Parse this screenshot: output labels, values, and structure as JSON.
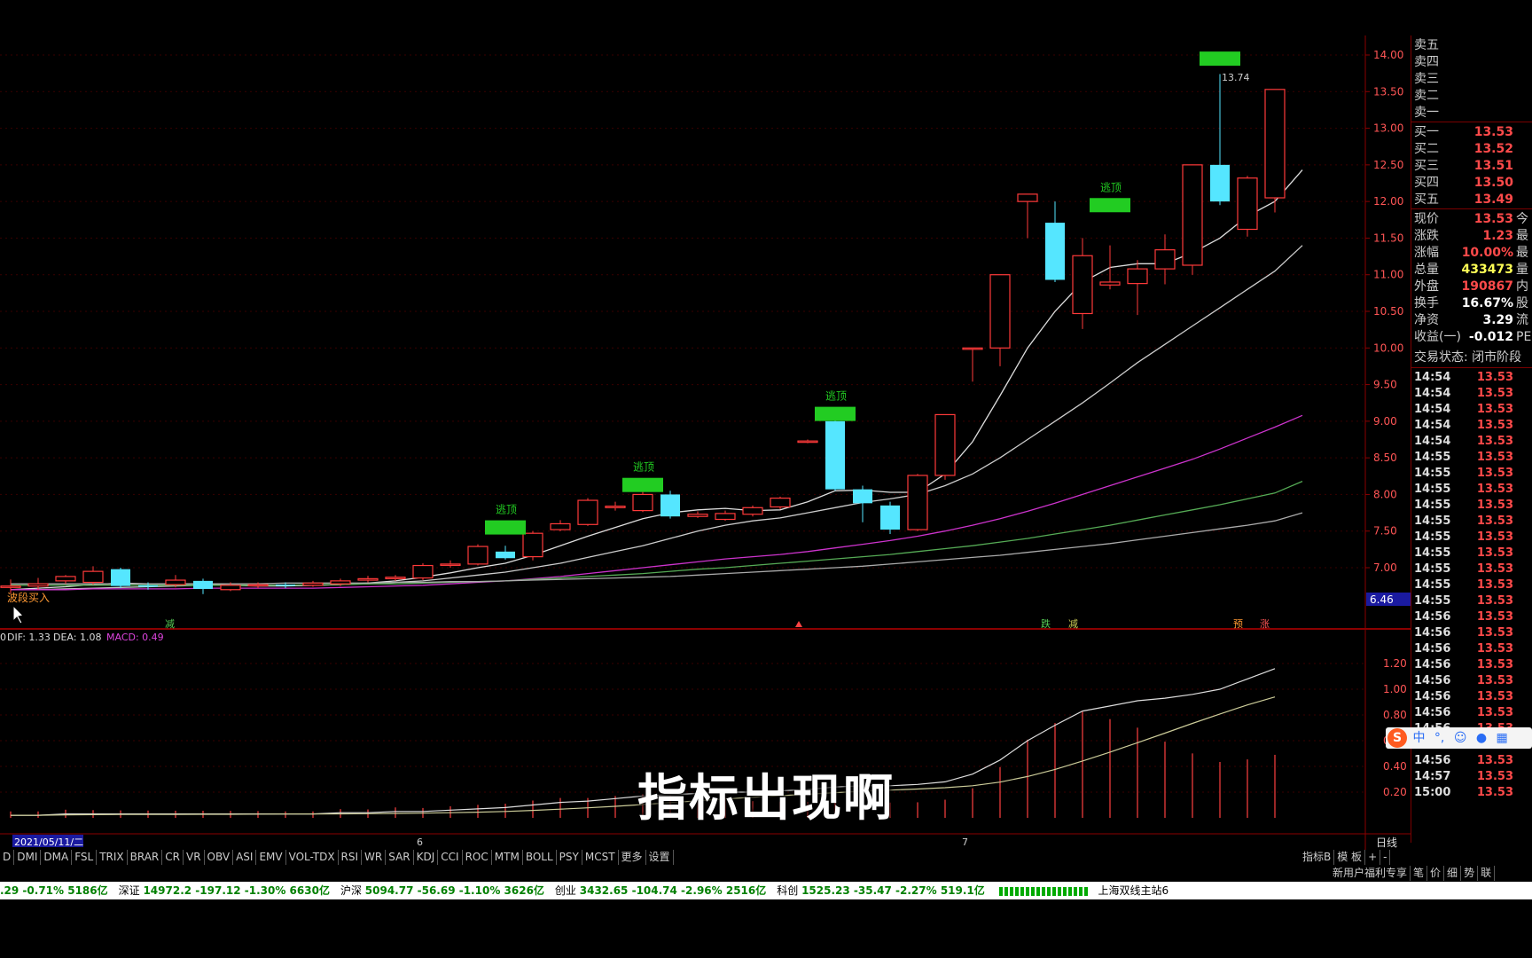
{
  "colors": {
    "up": "#ff3a3a",
    "down": "#55e6ff",
    "signal": "#22cc22",
    "ma5": "#dddddd",
    "ma10": "#cccccc",
    "ma20": "#cc33cc",
    "ma30": "#55aa55",
    "ma60": "#aaaaaa"
  },
  "chart": {
    "price_axis": [
      "14.00",
      "13.50",
      "13.00",
      "12.50",
      "12.00",
      "11.50",
      "11.00",
      "10.50",
      "10.00",
      "9.50",
      "9.00",
      "8.50",
      "8.00",
      "7.50",
      "7.00"
    ],
    "macd_axis": [
      "1.20",
      "1.00",
      "0.80",
      "0.60",
      "0.40",
      "0.20"
    ],
    "current_price_tag": "6.46",
    "high_label": "13.74",
    "buy_label": "波段买入",
    "top_labels": [
      "逃顶",
      "逃顶",
      "逃顶",
      "逃顶"
    ],
    "marker_labels": [
      "减",
      "跌",
      "减",
      "预",
      "涨"
    ],
    "macd_legend": {
      "dif": "DIF: 1.33",
      "dea": "DEA: 1.08",
      "macd": "MACD: 0.49"
    },
    "date_labels": [
      "2021/05/11/二",
      "6",
      "7"
    ],
    "period": "日线",
    "caption": "指标出现啊"
  },
  "chart_data": {
    "type": "candlestick",
    "series": [
      {
        "o": 6.73,
        "c": 6.75,
        "h": 6.84,
        "l": 6.65
      },
      {
        "o": 6.75,
        "c": 6.78,
        "h": 6.86,
        "l": 6.7
      },
      {
        "o": 6.82,
        "c": 6.88,
        "h": 6.9,
        "l": 6.78
      },
      {
        "o": 6.8,
        "c": 6.95,
        "h": 7.02,
        "l": 6.77
      },
      {
        "o": 6.98,
        "c": 6.75,
        "h": 7.0,
        "l": 6.72
      },
      {
        "o": 6.76,
        "c": 6.74,
        "h": 6.8,
        "l": 6.7
      },
      {
        "o": 6.77,
        "c": 6.83,
        "h": 6.9,
        "l": 6.73
      },
      {
        "o": 6.82,
        "c": 6.71,
        "h": 6.85,
        "l": 6.64
      },
      {
        "o": 6.7,
        "c": 6.76,
        "h": 6.8,
        "l": 6.68
      },
      {
        "o": 6.76,
        "c": 6.77,
        "h": 6.8,
        "l": 6.72
      },
      {
        "o": 6.77,
        "c": 6.76,
        "h": 6.8,
        "l": 6.72
      },
      {
        "o": 6.76,
        "c": 6.79,
        "h": 6.82,
        "l": 6.74
      },
      {
        "o": 6.78,
        "c": 6.82,
        "h": 6.85,
        "l": 6.75
      },
      {
        "o": 6.83,
        "c": 6.85,
        "h": 6.89,
        "l": 6.8
      },
      {
        "o": 6.85,
        "c": 6.87,
        "h": 6.9,
        "l": 6.82
      },
      {
        "o": 6.86,
        "c": 7.03,
        "h": 7.06,
        "l": 6.83
      },
      {
        "o": 7.04,
        "c": 7.05,
        "h": 7.1,
        "l": 7.0
      },
      {
        "o": 7.05,
        "c": 7.29,
        "h": 7.32,
        "l": 7.03
      },
      {
        "o": 7.22,
        "c": 7.13,
        "h": 7.3,
        "l": 7.11
      },
      {
        "o": 7.15,
        "c": 7.47,
        "h": 7.5,
        "l": 7.1
      },
      {
        "o": 7.52,
        "c": 7.6,
        "h": 7.65,
        "l": 7.5
      },
      {
        "o": 7.59,
        "c": 7.92,
        "h": 7.95,
        "l": 7.57
      },
      {
        "o": 7.82,
        "c": 7.84,
        "h": 7.9,
        "l": 7.78
      },
      {
        "o": 7.78,
        "c": 8.0,
        "h": 8.04,
        "l": 7.76
      },
      {
        "o": 8.0,
        "c": 7.7,
        "h": 8.05,
        "l": 7.67
      },
      {
        "o": 7.7,
        "c": 7.73,
        "h": 7.77,
        "l": 7.68
      },
      {
        "o": 7.66,
        "c": 7.74,
        "h": 7.78,
        "l": 7.64
      },
      {
        "o": 7.73,
        "c": 7.82,
        "h": 7.85,
        "l": 7.7
      },
      {
        "o": 7.83,
        "c": 7.95,
        "h": 7.97,
        "l": 7.8
      },
      {
        "o": 8.73,
        "c": 8.73,
        "h": 8.75,
        "l": 8.7
      },
      {
        "o": 9.0,
        "c": 8.07,
        "h": 9.1,
        "l": 8.05
      },
      {
        "o": 8.07,
        "c": 7.88,
        "h": 8.12,
        "l": 7.62
      },
      {
        "o": 7.85,
        "c": 7.52,
        "h": 7.9,
        "l": 7.46
      },
      {
        "o": 7.52,
        "c": 8.26,
        "h": 8.28,
        "l": 7.5
      },
      {
        "o": 8.26,
        "c": 9.09,
        "h": 9.09,
        "l": 8.2
      },
      {
        "o": 10.0,
        "c": 10.0,
        "h": 10.0,
        "l": 9.54
      },
      {
        "o": 10.0,
        "c": 11.0,
        "h": 11.0,
        "l": 9.75
      },
      {
        "o": 12.0,
        "c": 12.1,
        "h": 12.1,
        "l": 11.5
      },
      {
        "o": 11.71,
        "c": 10.93,
        "h": 12.0,
        "l": 10.9
      },
      {
        "o": 10.47,
        "c": 11.26,
        "h": 11.5,
        "l": 10.26
      },
      {
        "o": 10.86,
        "c": 10.9,
        "h": 11.4,
        "l": 10.8
      },
      {
        "o": 10.88,
        "c": 11.08,
        "h": 11.2,
        "l": 10.45
      },
      {
        "o": 11.08,
        "c": 11.34,
        "h": 11.55,
        "l": 10.87
      },
      {
        "o": 11.13,
        "c": 12.5,
        "h": 12.5,
        "l": 11.0
      },
      {
        "o": 12.5,
        "c": 12.0,
        "h": 13.74,
        "l": 11.95
      },
      {
        "o": 11.62,
        "c": 12.32,
        "h": 12.35,
        "l": 11.52
      },
      {
        "o": 12.05,
        "c": 13.53,
        "h": 13.53,
        "l": 11.85
      }
    ],
    "ma": [
      {
        "name": "MA5",
        "values": [
          6.7,
          6.72,
          6.74,
          6.77,
          6.79,
          6.78,
          6.78,
          6.78,
          6.76,
          6.75,
          6.75,
          6.76,
          6.77,
          6.79,
          6.82,
          6.87,
          6.93,
          7.0,
          7.06,
          7.17,
          7.3,
          7.43,
          7.55,
          7.67,
          7.75,
          7.79,
          7.81,
          7.78,
          7.79,
          7.9,
          8.05,
          8.06,
          8.03,
          8.03,
          8.28,
          8.72,
          9.35,
          10.0,
          10.5,
          10.9,
          11.1,
          11.15,
          11.15,
          11.3,
          11.5,
          11.8,
          12.0,
          12.43
        ]
      },
      {
        "name": "MA10",
        "values": [
          6.7,
          6.7,
          6.71,
          6.72,
          6.73,
          6.74,
          6.75,
          6.76,
          6.76,
          6.76,
          6.76,
          6.76,
          6.77,
          6.78,
          6.8,
          6.82,
          6.86,
          6.9,
          6.94,
          7.0,
          7.06,
          7.14,
          7.22,
          7.3,
          7.4,
          7.5,
          7.58,
          7.64,
          7.68,
          7.75,
          7.82,
          7.89,
          7.94,
          8.0,
          8.12,
          8.28,
          8.5,
          8.75,
          9.0,
          9.25,
          9.52,
          9.8,
          10.05,
          10.3,
          10.55,
          10.8,
          11.05,
          11.4
        ]
      },
      {
        "name": "MA20",
        "values": [
          6.7,
          6.7,
          6.7,
          6.71,
          6.71,
          6.71,
          6.71,
          6.72,
          6.72,
          6.72,
          6.72,
          6.72,
          6.73,
          6.74,
          6.75,
          6.76,
          6.78,
          6.8,
          6.82,
          6.85,
          6.88,
          6.92,
          6.96,
          7.0,
          7.04,
          7.08,
          7.12,
          7.15,
          7.18,
          7.22,
          7.27,
          7.32,
          7.37,
          7.43,
          7.5,
          7.58,
          7.67,
          7.77,
          7.88,
          8.0,
          8.12,
          8.24,
          8.36,
          8.48,
          8.62,
          8.77,
          8.92,
          9.08
        ]
      },
      {
        "name": "MA30",
        "values": [
          6.76,
          6.76,
          6.76,
          6.76,
          6.76,
          6.76,
          6.76,
          6.76,
          6.76,
          6.76,
          6.76,
          6.77,
          6.77,
          6.78,
          6.78,
          6.79,
          6.8,
          6.81,
          6.82,
          6.84,
          6.86,
          6.88,
          6.9,
          6.92,
          6.95,
          6.98,
          7.0,
          7.03,
          7.06,
          7.09,
          7.12,
          7.15,
          7.18,
          7.22,
          7.26,
          7.3,
          7.35,
          7.4,
          7.46,
          7.52,
          7.58,
          7.65,
          7.72,
          7.79,
          7.86,
          7.94,
          8.02,
          8.18
        ]
      },
      {
        "name": "MA60",
        "values": [
          6.78,
          6.78,
          6.78,
          6.78,
          6.78,
          6.78,
          6.78,
          6.78,
          6.78,
          6.78,
          6.79,
          6.79,
          6.79,
          6.79,
          6.8,
          6.8,
          6.81,
          6.81,
          6.82,
          6.83,
          6.84,
          6.85,
          6.86,
          6.87,
          6.88,
          6.9,
          6.92,
          6.94,
          6.96,
          6.98,
          7.0,
          7.02,
          7.05,
          7.08,
          7.11,
          7.14,
          7.17,
          7.21,
          7.25,
          7.29,
          7.33,
          7.38,
          7.43,
          7.48,
          7.53,
          7.58,
          7.64,
          7.75
        ]
      }
    ],
    "macd": {
      "dif": [
        0.02,
        0.02,
        0.03,
        0.03,
        0.03,
        0.03,
        0.03,
        0.03,
        0.03,
        0.03,
        0.03,
        0.03,
        0.04,
        0.04,
        0.05,
        0.05,
        0.06,
        0.07,
        0.08,
        0.1,
        0.12,
        0.13,
        0.15,
        0.17,
        0.18,
        0.19,
        0.2,
        0.2,
        0.21,
        0.22,
        0.24,
        0.25,
        0.25,
        0.26,
        0.28,
        0.34,
        0.45,
        0.6,
        0.72,
        0.83,
        0.87,
        0.91,
        0.93,
        0.96,
        1.0,
        1.08,
        1.16,
        1.22,
        1.33
      ]
    },
    "sell_signals": [
      {
        "index": 18,
        "price": 7.55
      },
      {
        "index": 23,
        "price": 8.13
      },
      {
        "index": 30,
        "price": 9.1
      },
      {
        "index": 40,
        "price": 11.95
      },
      {
        "index": 44,
        "price": 13.95
      }
    ],
    "xlabel": "",
    "ylabel": ""
  },
  "quote": {
    "asks": [
      {
        "label": "卖五",
        "value": ""
      },
      {
        "label": "卖四",
        "value": ""
      },
      {
        "label": "卖三",
        "value": ""
      },
      {
        "label": "卖二",
        "value": ""
      },
      {
        "label": "卖一",
        "value": ""
      }
    ],
    "bids": [
      {
        "label": "买一",
        "value": "13.53"
      },
      {
        "label": "买二",
        "value": "13.52"
      },
      {
        "label": "买三",
        "value": "13.51"
      },
      {
        "label": "买四",
        "value": "13.50"
      },
      {
        "label": "买五",
        "value": "13.49"
      }
    ],
    "stats": [
      {
        "label": "现价",
        "value": "13.53",
        "extra": "今"
      },
      {
        "label": "涨跌",
        "value": "1.23",
        "extra": "最"
      },
      {
        "label": "涨幅",
        "value": "10.00%",
        "extra": "最"
      },
      {
        "label": "总量",
        "value": "433473",
        "extra": "量"
      },
      {
        "label": "外盘",
        "value": "190867",
        "extra": "内"
      },
      {
        "label": "换手",
        "value": "16.67%",
        "extra": "股"
      },
      {
        "label": "净资",
        "value": "3.29",
        "extra": "流"
      },
      {
        "label": "收益(一)",
        "value": "-0.012",
        "extra": "PE"
      }
    ],
    "trade_status": "交易状态: 闭市阶段",
    "ticks": [
      {
        "time": "14:54",
        "price": "13.53"
      },
      {
        "time": "14:54",
        "price": "13.53"
      },
      {
        "time": "14:54",
        "price": "13.53"
      },
      {
        "time": "14:54",
        "price": "13.53"
      },
      {
        "time": "14:54",
        "price": "13.53"
      },
      {
        "time": "14:55",
        "price": "13.53"
      },
      {
        "time": "14:55",
        "price": "13.53"
      },
      {
        "time": "14:55",
        "price": "13.53"
      },
      {
        "time": "14:55",
        "price": "13.53"
      },
      {
        "time": "14:55",
        "price": "13.53"
      },
      {
        "time": "14:55",
        "price": "13.53"
      },
      {
        "time": "14:55",
        "price": "13.53"
      },
      {
        "time": "14:55",
        "price": "13.53"
      },
      {
        "time": "14:55",
        "price": "13.53"
      },
      {
        "time": "14:55",
        "price": "13.53"
      },
      {
        "time": "14:56",
        "price": "13.53"
      },
      {
        "time": "14:56",
        "price": "13.53"
      },
      {
        "time": "14:56",
        "price": "13.53"
      },
      {
        "time": "14:56",
        "price": "13.53"
      },
      {
        "time": "14:56",
        "price": "13.53"
      },
      {
        "time": "14:56",
        "price": "13.53"
      },
      {
        "time": "14:56",
        "price": "13.53"
      },
      {
        "time": "14:56",
        "price": "13.53"
      },
      {
        "time": "14:56",
        "price": "13.53"
      },
      {
        "time": "14:56",
        "price": "13.53"
      },
      {
        "time": "14:57",
        "price": "13.53"
      },
      {
        "time": "15:00",
        "price": "13.53"
      }
    ]
  },
  "tabs": [
    "D",
    "DMI",
    "DMA",
    "FSL",
    "TRIX",
    "BRAR",
    "CR",
    "VR",
    "OBV",
    "ASI",
    "EMV",
    "VOL-TDX",
    "RSI",
    "WR",
    "SAR",
    "KDJ",
    "CCI",
    "ROC",
    "MTM",
    "BOLL",
    "PSY",
    "MCST",
    "更多",
    "设置"
  ],
  "right_tabs": [
    "指标B",
    "模 板",
    "+",
    "-"
  ],
  "bottom_tabs": [
    "新用户福利专享",
    "笔",
    "价",
    "细",
    "势",
    "联"
  ],
  "status_bar": [
    {
      "name": "",
      "value": ".29 -0.71% 5186亿"
    },
    {
      "name": "深证",
      "value": "14972.2 -197.12 -1.30% 6630亿"
    },
    {
      "name": "沪深",
      "value": "5094.77 -56.69 -1.10% 3626亿"
    },
    {
      "name": "创业",
      "value": "3432.65 -104.74 -2.96% 2516亿"
    },
    {
      "name": "科创",
      "value": "1525.23 -35.47 -2.27% 519.1亿"
    }
  ],
  "server": "上海双线主站6",
  "ime": {
    "lang": "中"
  }
}
